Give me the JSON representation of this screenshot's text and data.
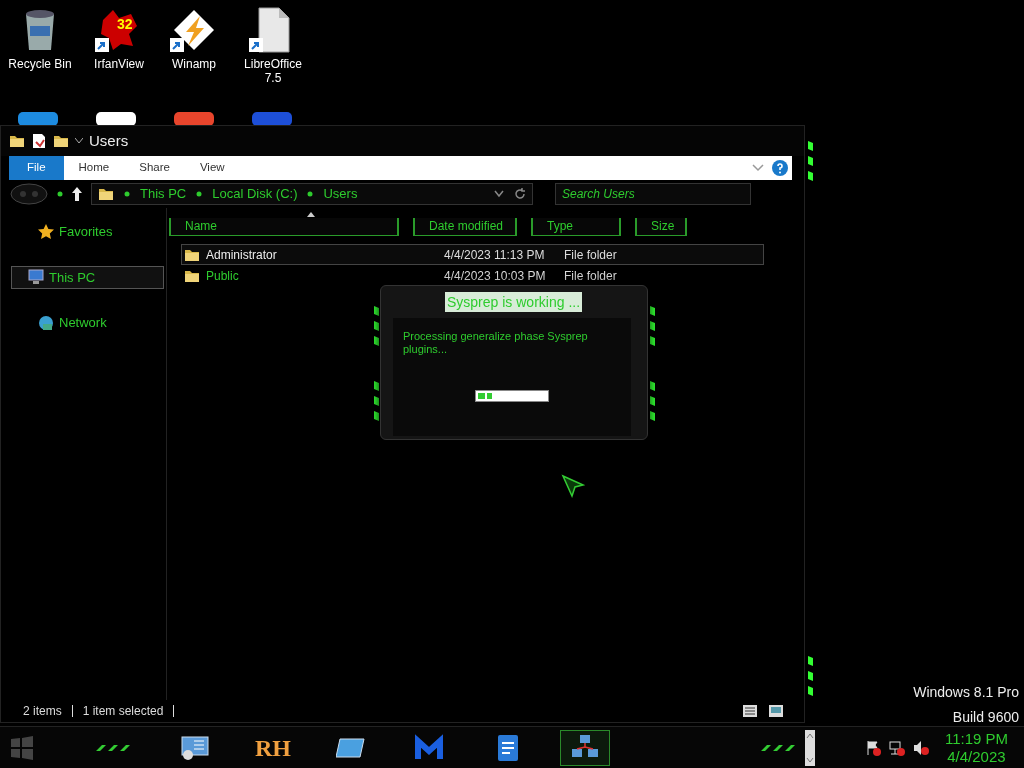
{
  "desktop_icons": [
    {
      "label": "Recycle Bin",
      "kind": "bin",
      "shortcut": false
    },
    {
      "label": "IrfanView",
      "kind": "irfan",
      "shortcut": true,
      "badge": "32"
    },
    {
      "label": "Winamp",
      "kind": "winamp",
      "shortcut": true
    },
    {
      "label": "LibreOffice 7.5",
      "kind": "libre",
      "shortcut": true
    }
  ],
  "explorer": {
    "title": "Users",
    "ribbon_tabs": [
      {
        "label": "File",
        "selected": true
      },
      {
        "label": "Home",
        "selected": false
      },
      {
        "label": "Share",
        "selected": false
      },
      {
        "label": "View",
        "selected": false
      }
    ],
    "breadcrumbs": [
      "This PC",
      "Local Disk (C:)",
      "Users"
    ],
    "search": {
      "placeholder": "Search Users"
    },
    "nav_items": [
      {
        "label": "Favorites",
        "kind": "star",
        "selected": false
      },
      {
        "label": "This PC",
        "kind": "pc",
        "selected": true
      },
      {
        "label": "Network",
        "kind": "network",
        "selected": false
      }
    ],
    "columns": [
      "Name",
      "Date modified",
      "Type",
      "Size"
    ],
    "rows": [
      {
        "name": "Administrator",
        "date": "4/4/2023 11:13 PM",
        "type": "File folder",
        "selected": true
      },
      {
        "name": "Public",
        "date": "4/4/2023 10:03 PM",
        "type": "File folder",
        "selected": false
      }
    ],
    "status_bar": {
      "count": "2 items",
      "selection": "1 item selected"
    }
  },
  "dialog": {
    "title": "Sysprep is working ...",
    "message": "Processing generalize phase Sysprep plugins...",
    "progress": {
      "level": 0.2
    }
  },
  "os_watermark": [
    "Windows 8.1 Pro",
    "Build 9600"
  ],
  "taskbar": {
    "apps": [
      {
        "kind": "panel",
        "selected": false
      },
      {
        "kind": "text",
        "label": "RH",
        "selected": false
      },
      {
        "kind": "screen",
        "selected": false
      },
      {
        "kind": "m",
        "selected": false
      },
      {
        "kind": "doc",
        "selected": false
      },
      {
        "kind": "net",
        "selected": true
      }
    ],
    "clock": {
      "time": "11:19 PM",
      "date": "4/4/2023"
    }
  }
}
